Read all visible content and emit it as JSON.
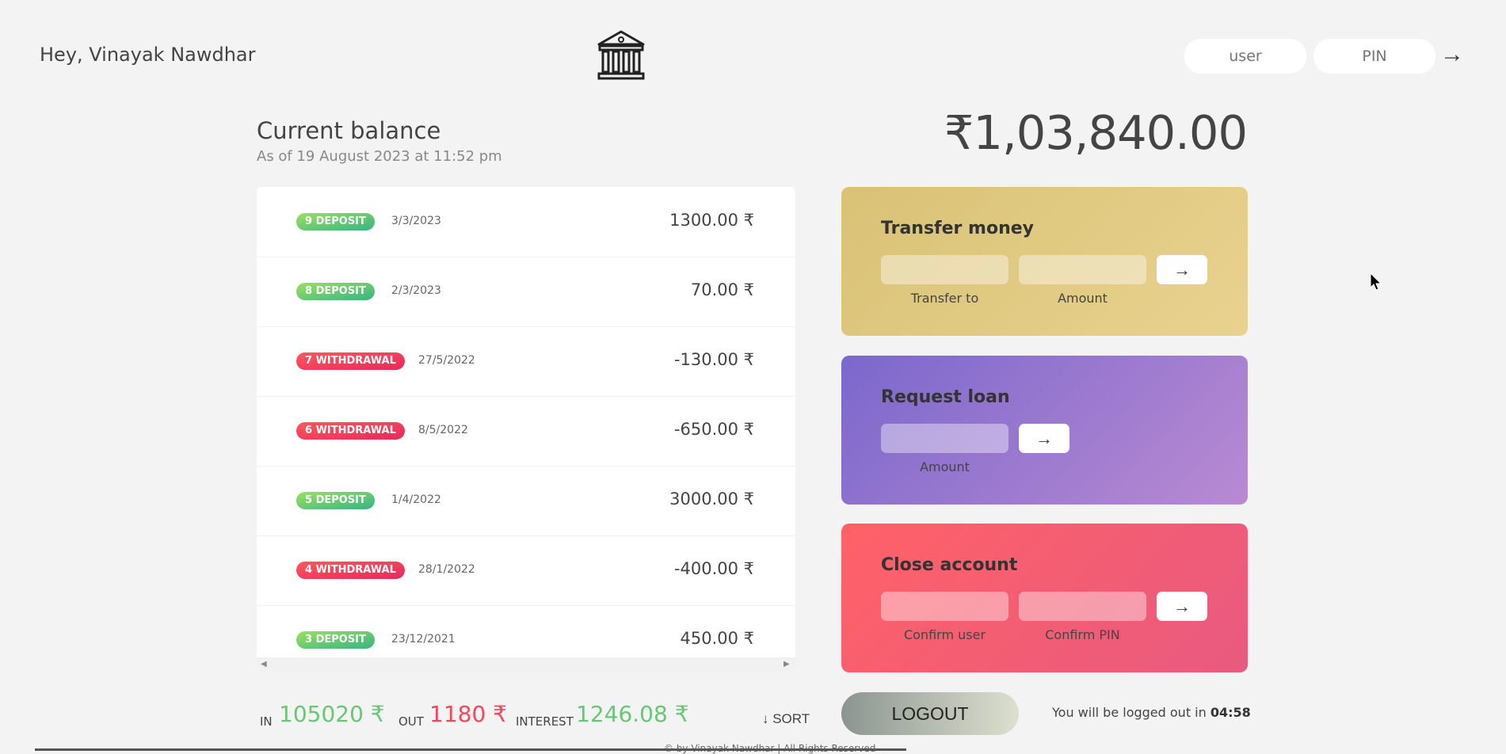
{
  "header": {
    "welcome": "Hey, Vinayak Nawdhar",
    "login_user_placeholder": "user",
    "login_pin_placeholder": "PIN",
    "login_button_icon": "arrow-right-icon"
  },
  "balance": {
    "label": "Current balance",
    "date": "As of 19 August 2023 at 11:52 pm",
    "value": "₹1,03,840.00"
  },
  "movements": [
    {
      "type_label": "9 deposit",
      "type": "deposit",
      "date": "3/3/2023",
      "value": "1300.00 ₹"
    },
    {
      "type_label": "8 deposit",
      "type": "deposit",
      "date": "2/3/2023",
      "value": "70.00 ₹"
    },
    {
      "type_label": "7 withdrawal",
      "type": "withdrawal",
      "date": "27/5/2022",
      "value": "-130.00 ₹"
    },
    {
      "type_label": "6 withdrawal",
      "type": "withdrawal",
      "date": "8/5/2022",
      "value": "-650.00 ₹"
    },
    {
      "type_label": "5 deposit",
      "type": "deposit",
      "date": "1/4/2022",
      "value": "3000.00 ₹"
    },
    {
      "type_label": "4 withdrawal",
      "type": "withdrawal",
      "date": "28/1/2022",
      "value": "-400.00 ₹"
    },
    {
      "type_label": "3 deposit",
      "type": "deposit",
      "date": "23/12/2021",
      "value": "450.00 ₹"
    }
  ],
  "operations": {
    "transfer": {
      "title": "Transfer money",
      "label_to": "Transfer to",
      "label_amount": "Amount",
      "button": "→"
    },
    "loan": {
      "title": "Request loan",
      "label_amount": "Amount",
      "button": "→"
    },
    "close": {
      "title": "Close account",
      "label_user": "Confirm user",
      "label_pin": "Confirm PIN",
      "button": "→"
    }
  },
  "summary": {
    "in_label": "In",
    "in_value": "105020 ₹",
    "out_label": "Out",
    "out_value": "1180 ₹",
    "interest_label": "Interest",
    "interest_value": "1246.08 ₹",
    "sort_label": "↓ SORT"
  },
  "logout": {
    "button": "LOGOUT",
    "timer_prefix": "You will be logged out in",
    "timer_value": "04:58"
  },
  "footer": {
    "text": "© by Vinayak Nawdhar | All Rights Reserved"
  },
  "colors": {
    "deposit": "#66c873",
    "withdrawal": "#f5465d",
    "transfer_bg": "#e0c97f",
    "loan_bg": "#9b7cd0",
    "close_bg": "#f0607a"
  }
}
